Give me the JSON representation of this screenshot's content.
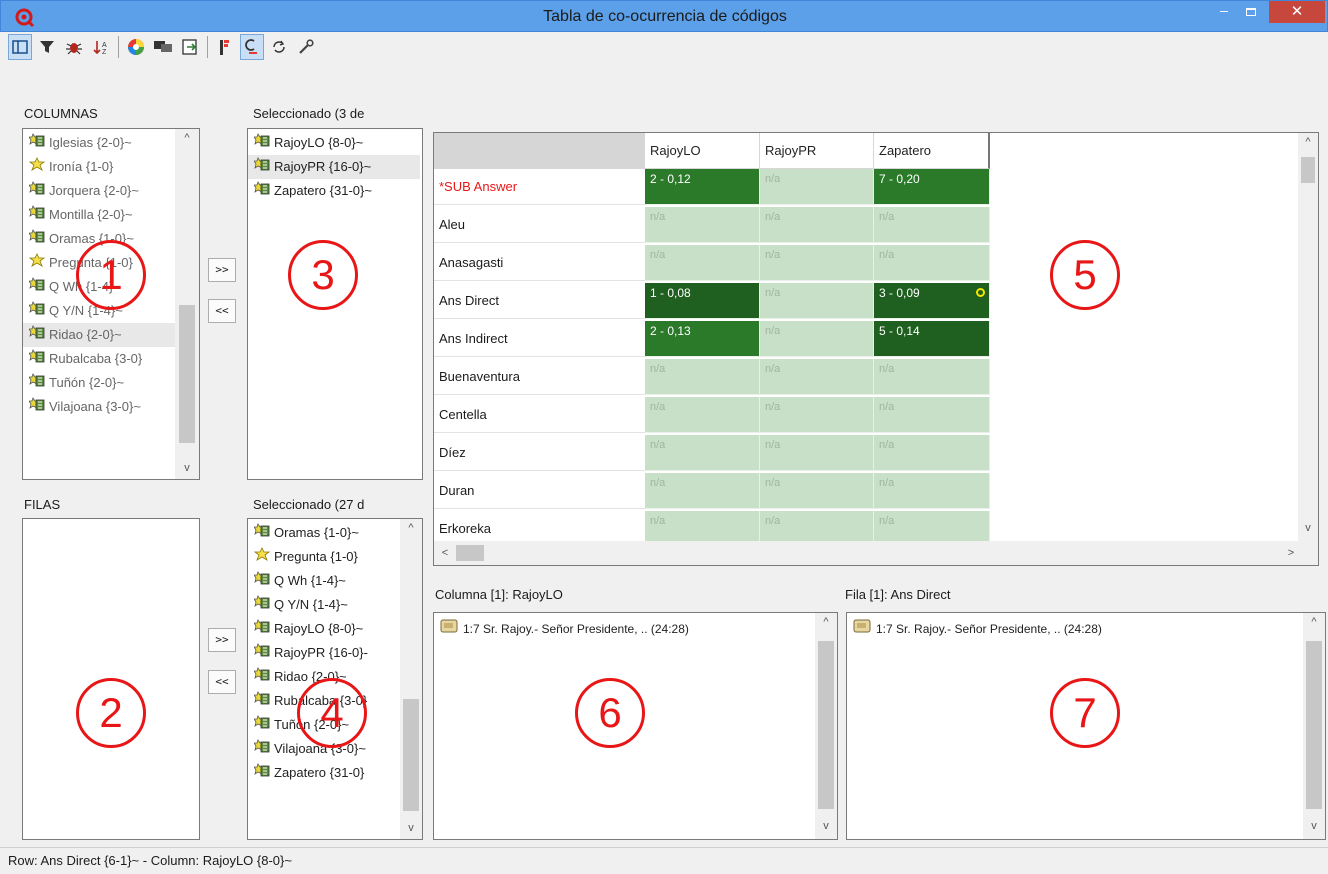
{
  "window": {
    "title": "Tabla de co-ocurrencia de códigos",
    "minimize": "–",
    "close": "✕"
  },
  "toolbar": {
    "icons": [
      "panel-icon",
      "filter-icon",
      "bug-icon",
      "sort-icon",
      "color-wheel-icon",
      "chat-icon",
      "export-icon",
      "bar-chart-icon",
      "cluster-icon",
      "refresh-icon",
      "wrench-icon"
    ]
  },
  "columns_panel": {
    "label": "COLUMNAS",
    "items": [
      {
        "label": "Iglesias {2-0}~",
        "icon": "code-group-icon"
      },
      {
        "label": "Ironía {1-0}",
        "icon": "code-star-icon"
      },
      {
        "label": "Jorquera {2-0}~",
        "icon": "code-group-icon"
      },
      {
        "label": "Montilla {2-0}~",
        "icon": "code-group-icon"
      },
      {
        "label": "Oramas {1-0}~",
        "icon": "code-group-icon"
      },
      {
        "label": "Pregunta {1-0}",
        "icon": "code-star-icon"
      },
      {
        "label": "Q Wh {1-4}~",
        "icon": "code-group-icon"
      },
      {
        "label": "Q Y/N {1-4}~",
        "icon": "code-group-icon"
      },
      {
        "label": "Ridao {2-0}~",
        "icon": "code-group-icon"
      },
      {
        "label": "Rubalcaba {3-0}",
        "icon": "code-group-icon"
      },
      {
        "label": "Tuñón {2-0}~",
        "icon": "code-group-icon"
      },
      {
        "label": "Vilajoana {3-0}~",
        "icon": "code-group-icon"
      }
    ]
  },
  "selected_columns": {
    "label": "Seleccionado (3 de",
    "items": [
      {
        "label": "RajoyLO {8-0}~"
      },
      {
        "label": "RajoyPR {16-0}~"
      },
      {
        "label": "Zapatero {31-0}~"
      }
    ]
  },
  "rows_panel": {
    "label": "FILAS"
  },
  "selected_rows": {
    "label": "Seleccionado (27 d",
    "items": [
      {
        "label": "Oramas {1-0}~",
        "icon": "code-group-icon"
      },
      {
        "label": "Pregunta {1-0}",
        "icon": "code-star-icon"
      },
      {
        "label": "Q Wh {1-4}~",
        "icon": "code-group-icon"
      },
      {
        "label": "Q Y/N {1-4}~",
        "icon": "code-group-icon"
      },
      {
        "label": "RajoyLO {8-0}~",
        "icon": "code-group-icon"
      },
      {
        "label": "RajoyPR {16-0}-",
        "icon": "code-group-icon"
      },
      {
        "label": "Ridao {2-0}~",
        "icon": "code-group-icon"
      },
      {
        "label": "Rubalcaba {3-0}",
        "icon": "code-group-icon"
      },
      {
        "label": "Tuñón {2-0}~",
        "icon": "code-group-icon"
      },
      {
        "label": "Vilajoana {3-0}~",
        "icon": "code-group-icon"
      },
      {
        "label": "Zapatero {31-0}",
        "icon": "code-group-icon"
      }
    ]
  },
  "move_buttons": {
    "add": ">>",
    "remove": "<<"
  },
  "table": {
    "columns": [
      "RajoyLO",
      "RajoyPR",
      "Zapatero"
    ],
    "rows": [
      {
        "label": "*SUB Answer",
        "red": true,
        "cells": [
          "2 - 0,12",
          "n/a",
          "7 - 0,20"
        ]
      },
      {
        "label": "Aleu",
        "cells": [
          "n/a",
          "n/a",
          "n/a"
        ]
      },
      {
        "label": "Anasagasti",
        "cells": [
          "n/a",
          "n/a",
          "n/a"
        ]
      },
      {
        "label": "Ans Direct",
        "cells": [
          "1 - 0,08",
          "n/a",
          "3 - 0,09"
        ]
      },
      {
        "label": "Ans Indirect",
        "cells": [
          "2 - 0,13",
          "n/a",
          "5 - 0,14"
        ]
      },
      {
        "label": "Buenaventura",
        "cells": [
          "n/a",
          "n/a",
          "n/a"
        ]
      },
      {
        "label": "Centella",
        "cells": [
          "n/a",
          "n/a",
          "n/a"
        ]
      },
      {
        "label": "Díez",
        "cells": [
          "n/a",
          "n/a",
          "n/a"
        ]
      },
      {
        "label": "Duran",
        "cells": [
          "n/a",
          "n/a",
          "n/a"
        ]
      },
      {
        "label": "Erkoreka",
        "cells": [
          "n/a",
          "n/a",
          "n/a"
        ]
      }
    ]
  },
  "column_quotes": {
    "label": "Columna [1]: RajoyLO",
    "items": [
      "1:7 Sr. Rajoy.- Señor Presidente, .. (24:28)"
    ]
  },
  "row_quotes": {
    "label": "Fila [1]: Ans Direct",
    "items": [
      "1:7 Sr. Rajoy.- Señor Presidente, .. (24:28)"
    ]
  },
  "annotations": [
    "1",
    "2",
    "3",
    "4",
    "5",
    "6",
    "7"
  ],
  "status": "Row: Ans Direct {6-1}~ - Column: RajoyLO {8-0}~",
  "colors": {
    "titlebar": "#5ba0e8",
    "close": "#c7473d",
    "cell_value": "#2a7a2a",
    "cell_na": "#c8dfc8",
    "annotation": "#e81616",
    "row_red": "#e81616"
  }
}
